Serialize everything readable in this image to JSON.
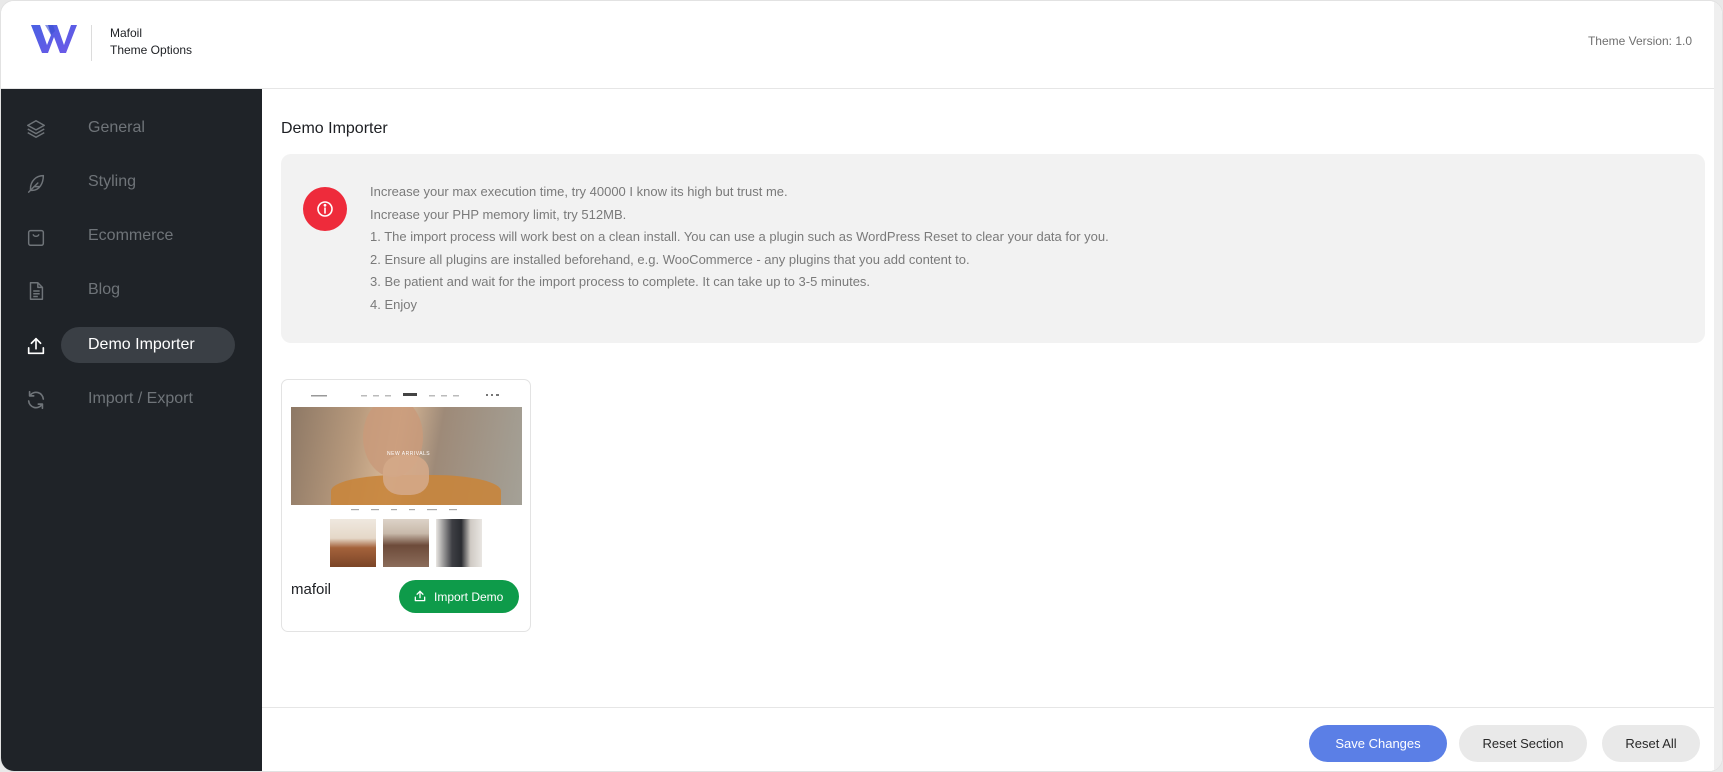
{
  "header": {
    "brand_name": "Mafoil",
    "brand_subtitle": "Theme Options",
    "version": "Theme Version: 1.0"
  },
  "sidebar": {
    "items": [
      {
        "label": "General",
        "icon": "layers-icon"
      },
      {
        "label": "Styling",
        "icon": "feather-icon"
      },
      {
        "label": "Ecommerce",
        "icon": "shopping-bag-icon"
      },
      {
        "label": "Blog",
        "icon": "document-icon"
      },
      {
        "label": "Demo Importer",
        "icon": "upload-icon",
        "active": true
      },
      {
        "label": "Import / Export",
        "icon": "refresh-icon"
      }
    ]
  },
  "main": {
    "title": "Demo Importer",
    "notice": {
      "icon": "info-icon",
      "lines": [
        "Increase your max execution time, try 40000 I know its high but trust me.",
        "Increase your PHP memory limit, try 512MB.",
        "1. The import process will work best on a clean install. You can use a plugin such as WordPress Reset to clear your data for you.",
        "2. Ensure all plugins are installed beforehand, e.g. WooCommerce - any plugins that you add content to.",
        "3. Be patient and wait for the import process to complete. It can take up to 3-5 minutes.",
        "4. Enjoy"
      ]
    },
    "demos": [
      {
        "name": "mafoil",
        "button_label": "Import Demo",
        "thumbnail_hero_text": "NEW ARRIVALS"
      }
    ]
  },
  "footer": {
    "save_label": "Save Changes",
    "reset_section_label": "Reset Section",
    "reset_all_label": "Reset All"
  },
  "colors": {
    "sidebar_bg": "#1f2328",
    "accent_blue": "#5b7fe6",
    "import_green": "#0e9b4a",
    "notice_red": "#ee2b3b"
  }
}
